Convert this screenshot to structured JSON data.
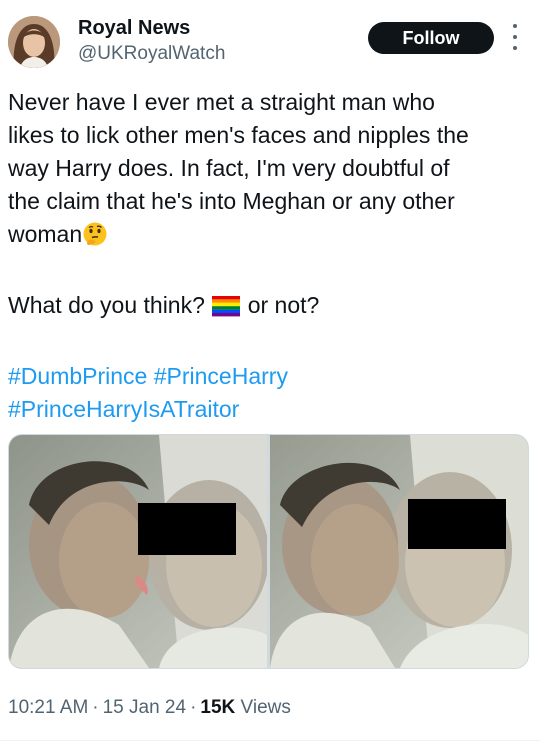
{
  "author": {
    "name": "Royal News",
    "handle": "@UKRoyalWatch",
    "follow_label": "Follow",
    "more_icon": "more-vertical-icon"
  },
  "tweet": {
    "line1": "Never have I ever met a straight man who",
    "line2": "likes to lick other men's faces and nipples the",
    "line3": "way Harry does. In fact, I'm very doubtful of",
    "line4": "the claim that he's into Meghan or any other",
    "line5": "woman",
    "question_start": "What do you think?",
    "question_end": "or not?",
    "emojis": [
      "thinking-face-emoji",
      "rainbow-flag-emoji"
    ],
    "hashtags": [
      "#DumbPrince",
      "#PrinceHarry",
      "#PrinceHarryIsATraitor"
    ]
  },
  "media": {
    "count": 2
  },
  "meta": {
    "time": "10:21 AM",
    "date": "15 Jan 24",
    "views_count": "15K",
    "views_label": "Views",
    "separator": "·"
  },
  "colors": {
    "text": "#0f1419",
    "secondary": "#536471",
    "link": "#1d9bf0",
    "button_bg": "#0f1419"
  }
}
